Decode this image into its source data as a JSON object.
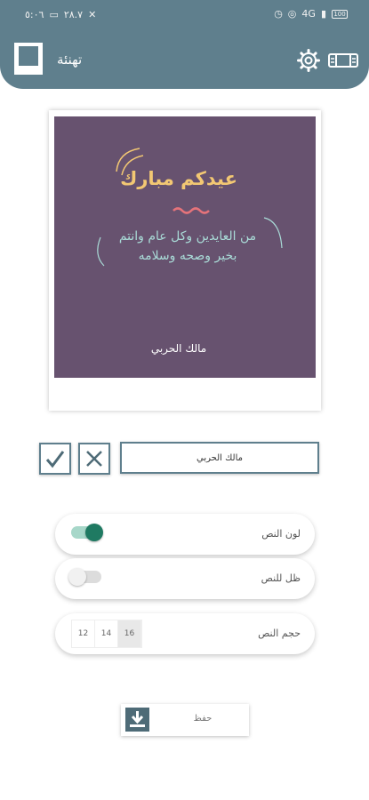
{
  "status_bar": {
    "time": "٥:٠٦",
    "speed": "٢٨.٧",
    "signal": "4G",
    "battery": "100"
  },
  "header": {
    "title": "تهنئة",
    "background": "#5f7f8d"
  },
  "card": {
    "background": "#67526f",
    "title": "عيدكم مبارك",
    "body_line1": "من العايدين وكل عام وانتم",
    "body_line2": "بخير وصحه وسلامه",
    "signature": "مالك الحربي",
    "title_color": "#f3c873",
    "body_color": "#a9dbd7"
  },
  "editor": {
    "name_value": "مالك الحربي",
    "confirm_icon": "check-icon",
    "cancel_icon": "close-icon"
  },
  "options": {
    "text_color_label": "لون النص",
    "text_color_enabled": true,
    "text_shadow_label": "ظل للنص",
    "text_shadow_enabled": false,
    "text_size_label": "حجم النص",
    "sizes": [
      "16",
      "14",
      "12"
    ],
    "selected_size": "16"
  },
  "save": {
    "label": "حفظ",
    "icon": "download-icon"
  }
}
